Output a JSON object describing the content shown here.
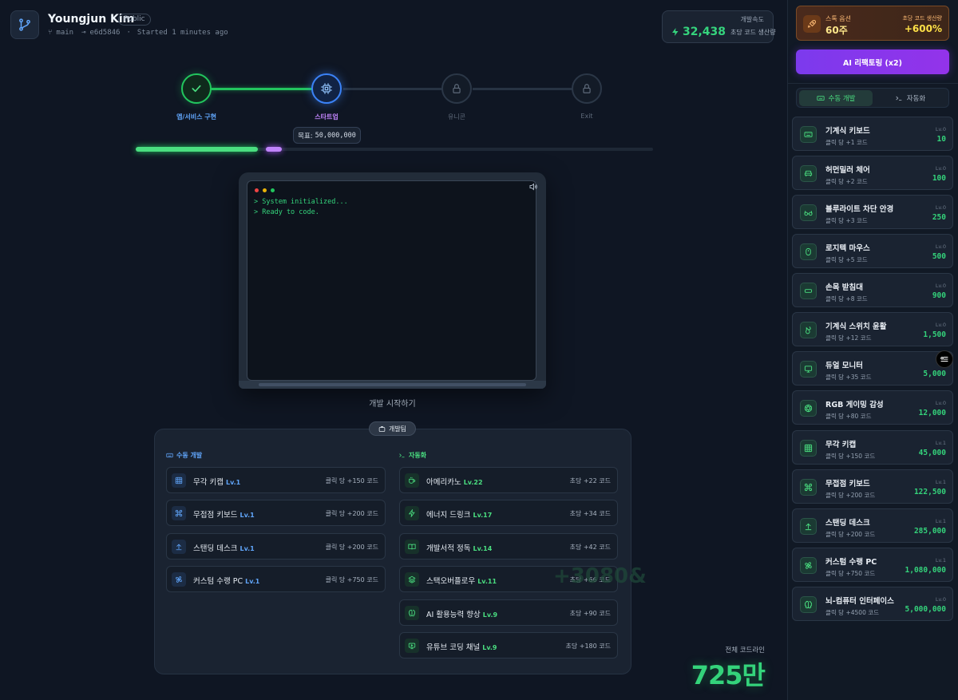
{
  "header": {
    "owner": "Youngjun Kim",
    "visibility": "Public",
    "branch": "main",
    "commit": "e6d5846",
    "separator": "·",
    "started": "Started 1 minutes ago"
  },
  "speed": {
    "label": "개발속도",
    "value": "32,438",
    "unit": "초당 코드 생산량"
  },
  "stepper": {
    "steps": [
      {
        "label": "앱/서비스 구현",
        "state": "done"
      },
      {
        "label": "스타트업",
        "state": "active"
      },
      {
        "label": "유니콘",
        "state": "locked"
      },
      {
        "label": "Exit",
        "state": "locked"
      }
    ],
    "target_label": "목표:",
    "target_value": "50,000,000",
    "progress_done_fraction": 0.236,
    "progress_current_fraction": 0.031
  },
  "terminal": {
    "lines": [
      "> System initialized...",
      "> Ready to code."
    ]
  },
  "start_label": "개발 시작하기",
  "team": {
    "title": "개발팀",
    "manual_title": "수동 개발",
    "auto_title": "자동화",
    "manual": [
      {
        "name": "무각 키캡",
        "level": "Lv.1",
        "rate": "클릭 당 +150 코드",
        "icon": "grid-icon"
      },
      {
        "name": "무접점 키보드",
        "level": "Lv.1",
        "rate": "클릭 당 +200 코드",
        "icon": "command-icon"
      },
      {
        "name": "스탠딩 데스크",
        "level": "Lv.1",
        "rate": "클릭 당 +200 코드",
        "icon": "arrow-up-icon"
      },
      {
        "name": "커스텀 수랭 PC",
        "level": "Lv.1",
        "rate": "클릭 당 +750 코드",
        "icon": "fan-icon"
      }
    ],
    "auto": [
      {
        "name": "아메리카노",
        "level": "Lv.22",
        "rate": "초당 +22 코드",
        "icon": "coffee-icon"
      },
      {
        "name": "에너지 드링크",
        "level": "Lv.17",
        "rate": "초당 +34 코드",
        "icon": "bolt-icon"
      },
      {
        "name": "개발서적 정독",
        "level": "Lv.14",
        "rate": "초당 +42 코드",
        "icon": "book-icon"
      },
      {
        "name": "스택오버플로우",
        "level": "Lv.11",
        "rate": "초당 +66 코드",
        "icon": "layers-icon"
      },
      {
        "name": "AI 활용능력 향상",
        "level": "Lv.9",
        "rate": "초당 +90 코드",
        "icon": "brain-icon"
      },
      {
        "name": "유튜브 코딩 채널",
        "level": "Lv.9",
        "rate": "초당 +180 코드",
        "icon": "tv-icon"
      }
    ]
  },
  "floating_text": "+3080&",
  "total": {
    "label": "전체 코드라인",
    "value": "725만"
  },
  "sidebar": {
    "stock": {
      "label": "스톡 옵션",
      "value": "60주",
      "sub": "초당 코드 생산량",
      "pct": "+600%"
    },
    "ai_button": "AI 리팩토링 (x2)",
    "tabs": [
      {
        "label": "수동 개발",
        "active": true
      },
      {
        "label": "자동화",
        "active": false
      }
    ],
    "upgrades": [
      {
        "name": "기계식 키보드",
        "desc": "클릭 당 +1 코드",
        "level": "Lv.0",
        "cost": "10",
        "icon": "keyboard-icon"
      },
      {
        "name": "허먼밀러 체어",
        "desc": "클릭 당 +2 코드",
        "level": "Lv.0",
        "cost": "100",
        "icon": "chair-icon"
      },
      {
        "name": "블루라이트 차단 안경",
        "desc": "클릭 당 +3 코드",
        "level": "Lv.0",
        "cost": "250",
        "icon": "glasses-icon"
      },
      {
        "name": "로지텍 마우스",
        "desc": "클릭 당 +5 코드",
        "level": "Lv.0",
        "cost": "500",
        "icon": "mouse-icon"
      },
      {
        "name": "손목 받침대",
        "desc": "클릭 당 +8 코드",
        "level": "Lv.0",
        "cost": "900",
        "icon": "rest-icon"
      },
      {
        "name": "기계식 스위치 윤활",
        "desc": "클릭 당 +12 코드",
        "level": "Lv.0",
        "cost": "1,500",
        "icon": "drop-icon"
      },
      {
        "name": "듀얼 모니터",
        "desc": "클릭 당 +35 코드",
        "level": "",
        "cost": "5,000",
        "icon": "monitor-icon"
      },
      {
        "name": "RGB 게이밍 감성",
        "desc": "클릭 당 +80 코드",
        "level": "Lv.0",
        "cost": "12,000",
        "icon": "aperture-icon"
      },
      {
        "name": "무각 키캡",
        "desc": "클릭 당 +150 코드",
        "level": "Lv.1",
        "cost": "45,000",
        "icon": "grid-icon"
      },
      {
        "name": "무접점 키보드",
        "desc": "클릭 당 +200 코드",
        "level": "Lv.1",
        "cost": "122,500",
        "icon": "command-icon"
      },
      {
        "name": "스탠딩 데스크",
        "desc": "클릭 당 +200 코드",
        "level": "Lv.1",
        "cost": "285,000",
        "icon": "arrow-up-icon"
      },
      {
        "name": "커스텀 수랭 PC",
        "desc": "클릭 당 +750 코드",
        "level": "Lv.1",
        "cost": "1,080,000",
        "icon": "fan-icon"
      },
      {
        "name": "뇌-컴퓨터 인터페이스",
        "desc": "클릭 당 +4500 코드",
        "level": "Lv.0",
        "cost": "5,000,000",
        "icon": "brain-icon"
      }
    ]
  },
  "colors": {
    "accent_green": "#22c55e",
    "accent_blue": "#3b82f6",
    "accent_purple": "#a855f7",
    "stock_orange": "#f97316"
  }
}
